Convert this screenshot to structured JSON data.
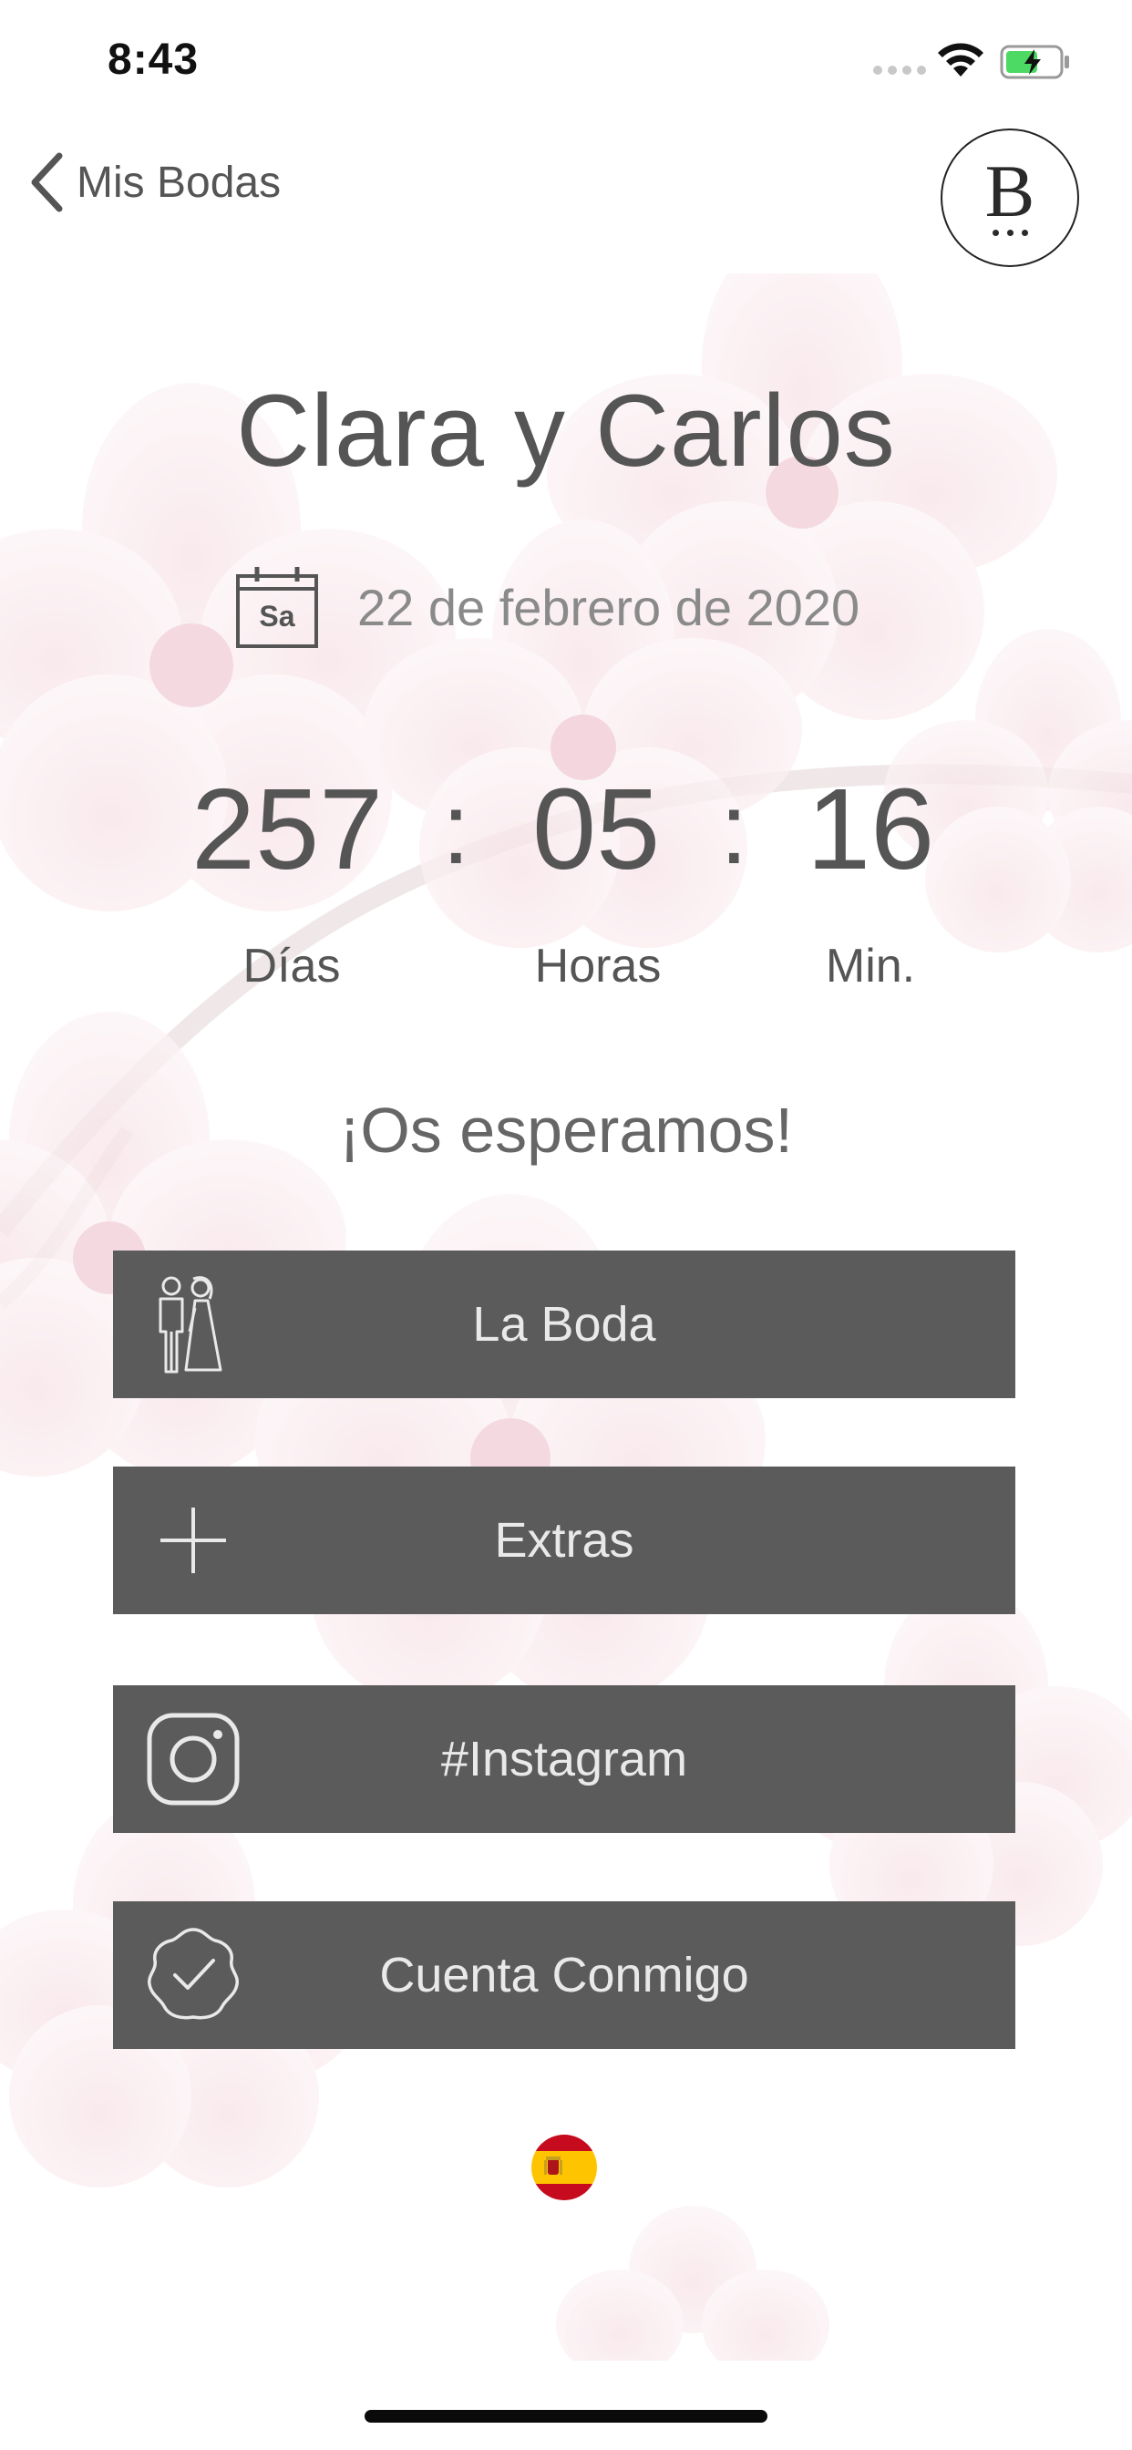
{
  "status_bar": {
    "time": "8:43"
  },
  "nav": {
    "back_label": "Mis Bodas",
    "logo_letter": "B"
  },
  "event": {
    "couple": "Clara y Carlos",
    "weekday_abbr": "Sa",
    "date": "22 de febrero de 2020"
  },
  "countdown": {
    "days": "257",
    "hours": "05",
    "minutes": "16",
    "separator": ":",
    "days_label": "Días",
    "hours_label": "Horas",
    "minutes_label": "Min."
  },
  "slogan": "¡Os esperamos!",
  "menu": [
    {
      "label": "La Boda",
      "icon": "bride-groom-icon"
    },
    {
      "label": "Extras",
      "icon": "plus-icon"
    },
    {
      "label": "#Instagram",
      "icon": "instagram-icon"
    },
    {
      "label": "Cuenta Conmigo",
      "icon": "verified-badge-icon"
    }
  ],
  "language": {
    "icon": "spain-flag-icon"
  },
  "colors": {
    "button_bg": "#5b5b5b",
    "button_text": "#e9e9e9",
    "text": "#555555",
    "blossom": "#f3d9de"
  }
}
